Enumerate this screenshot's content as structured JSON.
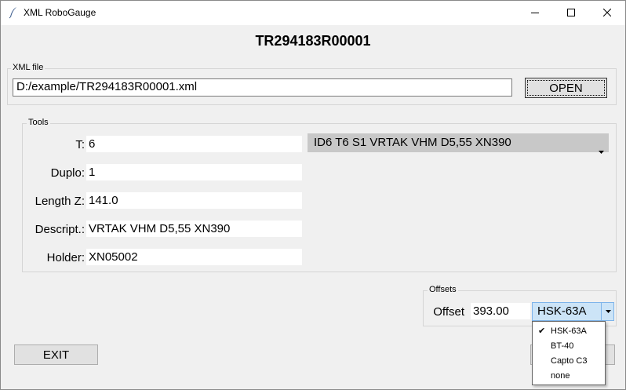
{
  "window": {
    "title": "XML RoboGauge",
    "controls": {
      "minimize": "minimize-icon",
      "maximize": "maximize-icon",
      "close": "close-icon"
    }
  },
  "header": {
    "title": "TR294183R00001"
  },
  "xml_file": {
    "group_label": "XML file",
    "path": "D:/example/TR294183R00001.xml",
    "open_label": "OPEN"
  },
  "tools": {
    "group_label": "Tools",
    "fields": [
      {
        "label": "T:",
        "value": "6"
      },
      {
        "label": "Duplo:",
        "value": "1"
      },
      {
        "label": "Length Z:",
        "value": "141.0"
      },
      {
        "label": "Descript.:",
        "value": "VRTAK VHM D5,55 XN390"
      },
      {
        "label": "Holder:",
        "value": "XN05002"
      }
    ],
    "selector_value": "ID6  T6  S1  VRTAK VHM D5,55 XN390"
  },
  "offsets": {
    "group_label": "Offsets",
    "offset_label": "Offset",
    "offset_value": "393.00",
    "holder_type_selected": "HSK-63A",
    "holder_type_options": [
      "HSK-63A",
      "BT-40",
      "Capto C3",
      "none"
    ],
    "checked_option": "HSK-63A"
  },
  "footer": {
    "exit_label": "EXIT"
  },
  "colors": {
    "window_bg": "#f0f0f0",
    "titlebar_bg": "#ffffff",
    "combo_bg": "#c8c8c8",
    "combo_active_bg": "#cce4f7",
    "combo_active_border": "#7eb4ea"
  }
}
